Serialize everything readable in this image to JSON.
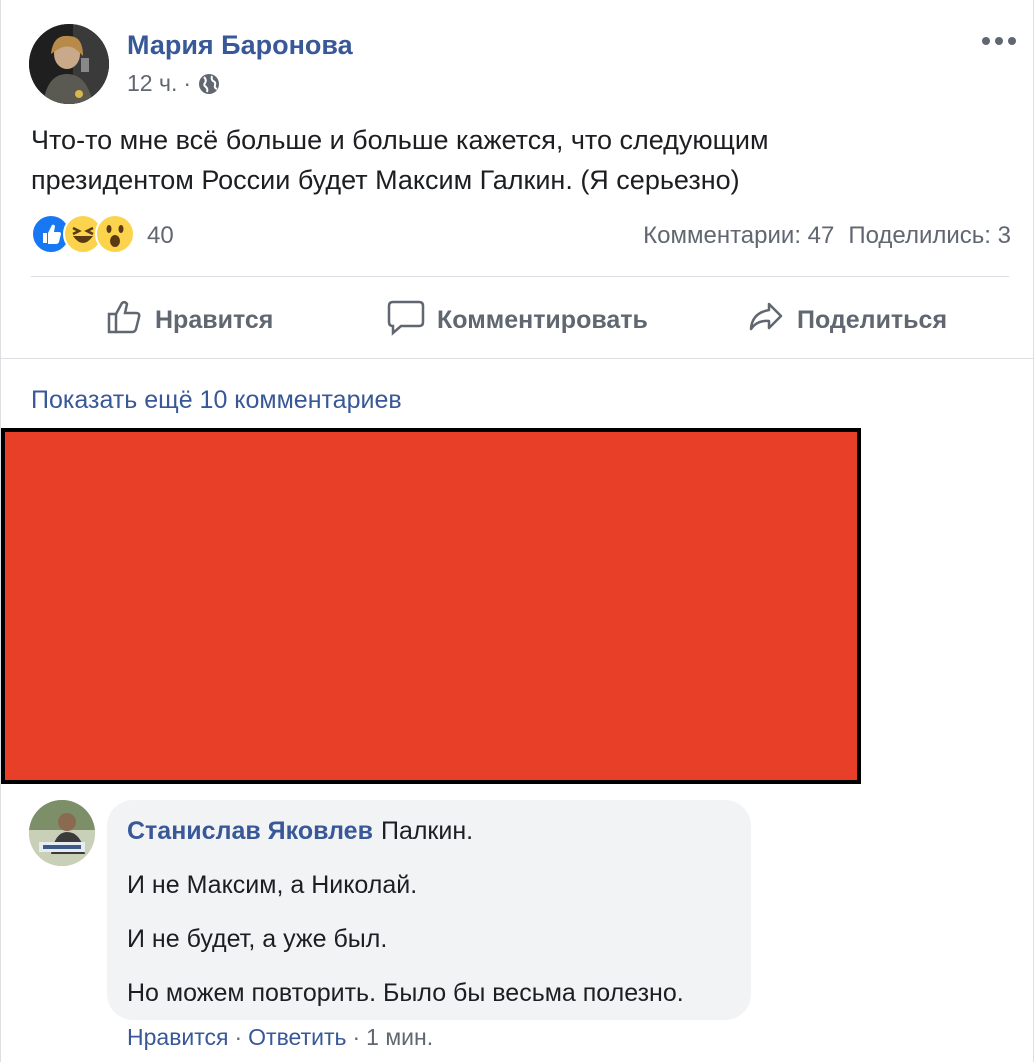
{
  "post": {
    "author": "Мария Баронова",
    "time": "12 ч.",
    "meta_sep": "·",
    "text_line1": "Что-то мне всё больше и больше кажется, что следующим",
    "text_line2": "президентом России будет Максим Галкин. (Я серьезно)",
    "privacy_icon": "globe-icon",
    "menu_icon": "more-horizontal-icon"
  },
  "reactions": {
    "icons": [
      "like-icon",
      "haha-icon",
      "wow-icon"
    ],
    "count": "40",
    "comments_label": "Комментарии: 47",
    "shares_label": "Поделились: 3"
  },
  "actions": {
    "like": "Нравится",
    "comment": "Комментировать",
    "share": "Поделиться"
  },
  "comments_section": {
    "show_more": "Показать ещё 10 комментариев"
  },
  "comment": {
    "author": "Станислав Яковлев",
    "line1": "Палкин.",
    "line2": "И не Максим, а Николай.",
    "line3": "И не будет, а уже был.",
    "line4": "Но можем повторить. Было бы весьма полезно.",
    "like_label": "Нравится",
    "reply_label": "Ответить",
    "time": "1 мин.",
    "sep": "·"
  },
  "colors": {
    "link_blue": "#385898",
    "redaction_red": "#e84028",
    "like_blue": "#1877f2",
    "emoji_yellow": "#fcd34d"
  }
}
